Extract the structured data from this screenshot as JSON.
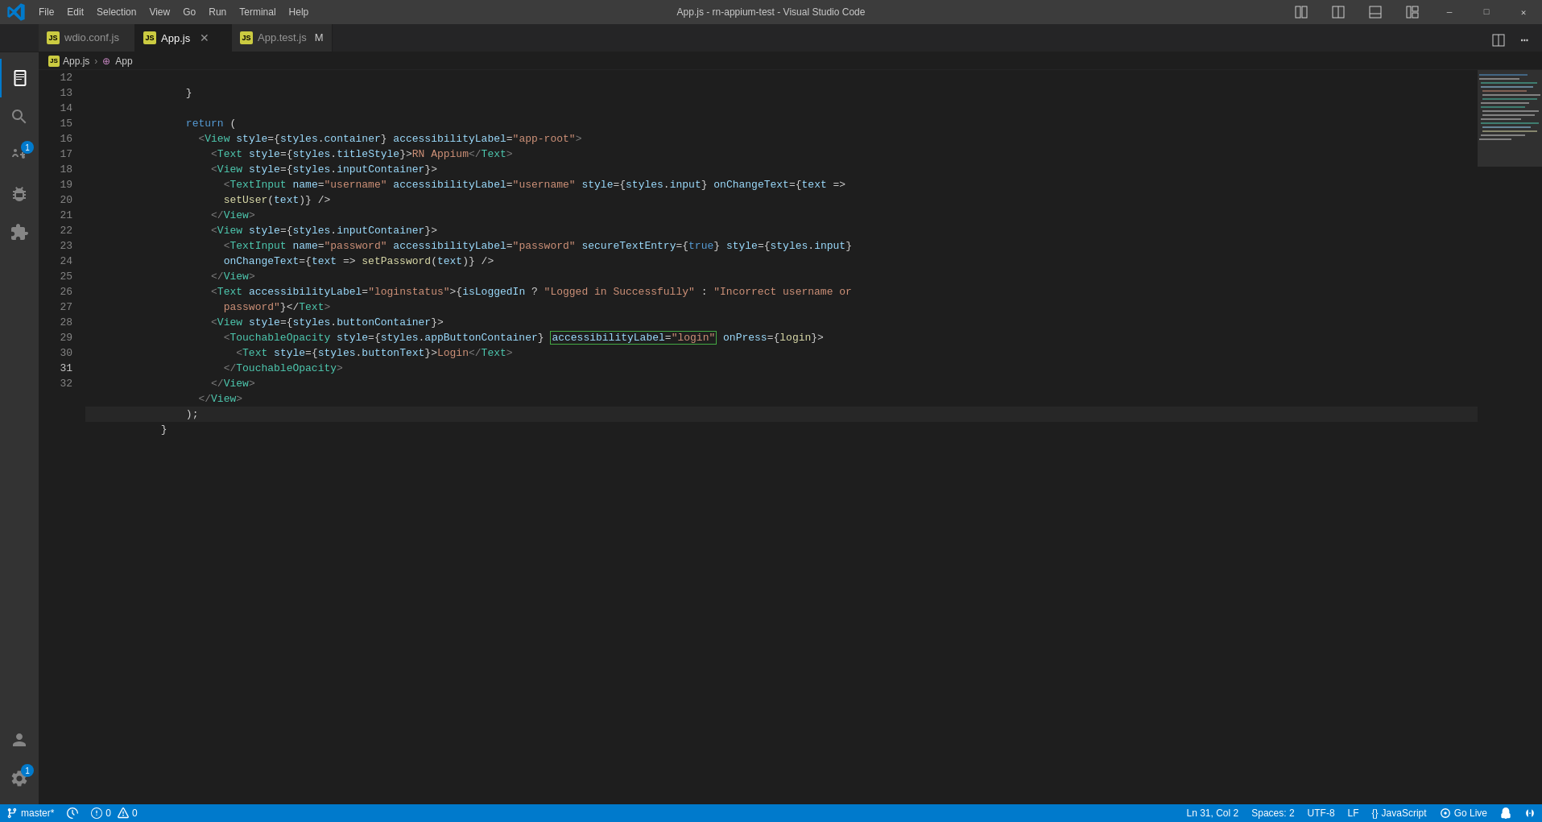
{
  "titleBar": {
    "title": "App.js - rn-appium-test - Visual Studio Code",
    "menu": [
      "File",
      "Edit",
      "Selection",
      "View",
      "Go",
      "Run",
      "Terminal",
      "Help"
    ]
  },
  "tabs": [
    {
      "id": "wdio",
      "label": "wdio.conf.js",
      "active": false,
      "modified": false
    },
    {
      "id": "app",
      "label": "App.js",
      "active": true,
      "modified": false
    },
    {
      "id": "apptest",
      "label": "App.test.js",
      "active": false,
      "modified": true
    }
  ],
  "breadcrumb": {
    "file": "App.js",
    "symbol": "App"
  },
  "lines": {
    "start": 12,
    "active": 31
  },
  "statusBar": {
    "branch": "master*",
    "errors": "0",
    "warnings": "0",
    "position": "Ln 31, Col 2",
    "spaces": "Spaces: 2",
    "encoding": "UTF-8",
    "lineEnding": "LF",
    "language": "JavaScript",
    "goLive": "Go Live"
  }
}
